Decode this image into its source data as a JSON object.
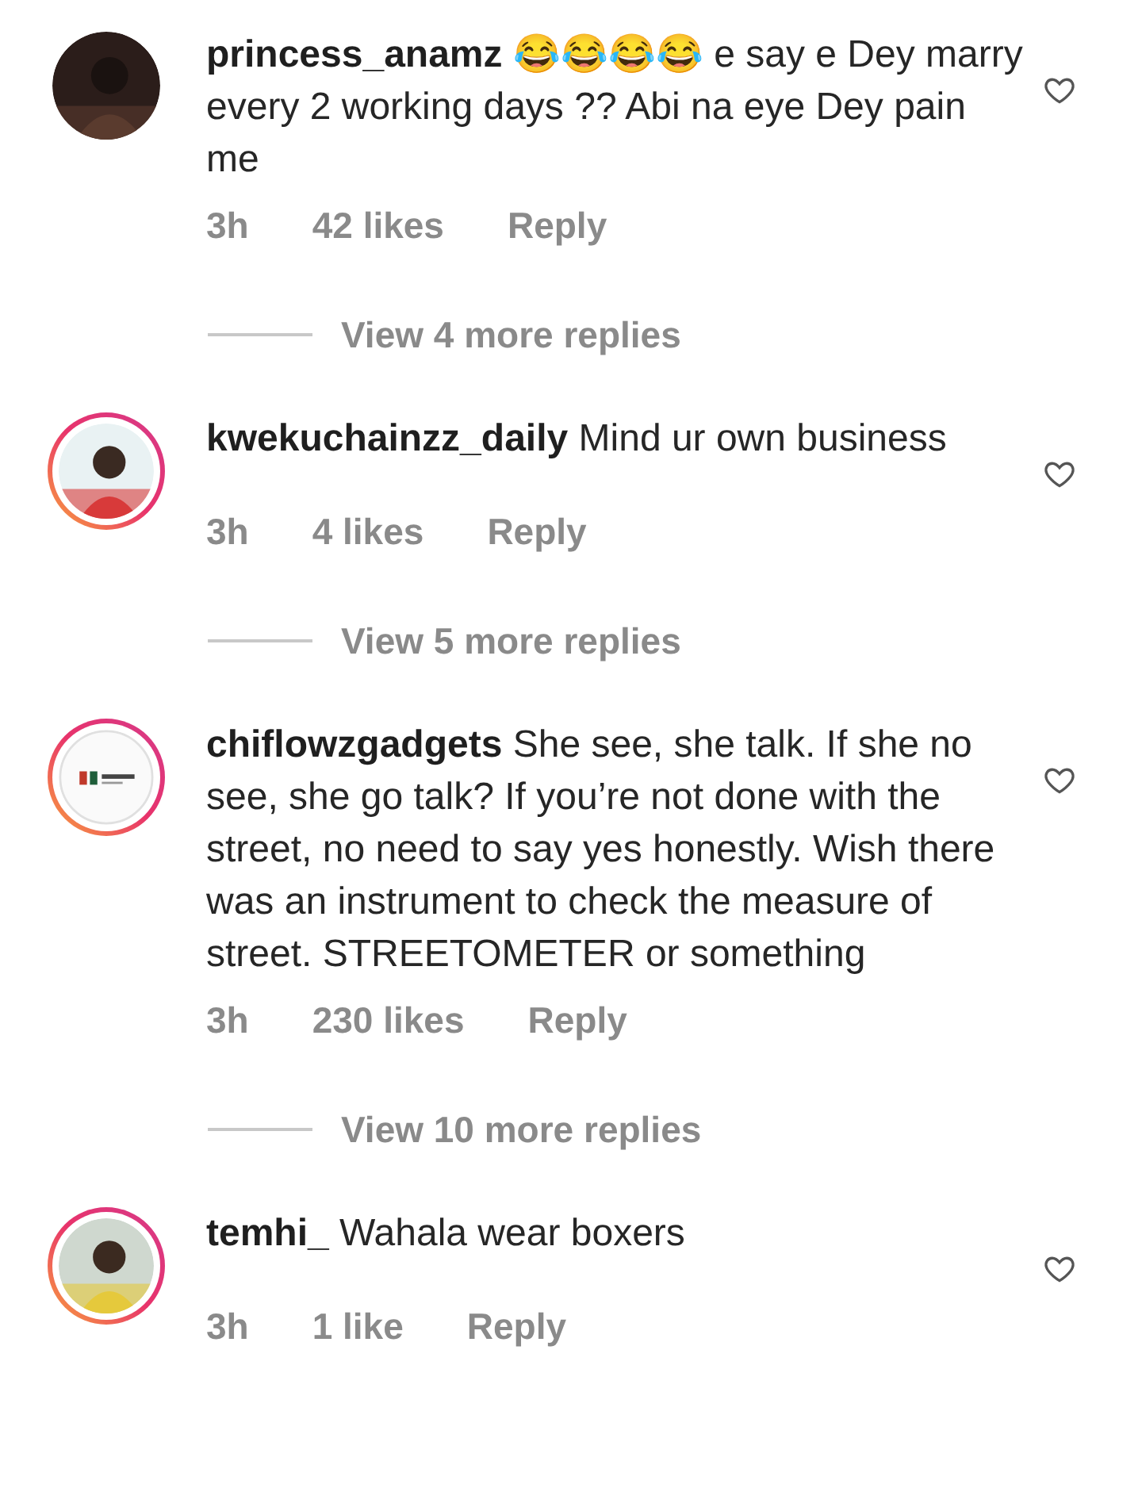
{
  "comments": [
    {
      "username": "princess_anamz",
      "text": "😂😂😂😂 e say e Dey marry every 2 working days ?? Abi na eye Dey pain me",
      "time": "3h",
      "likes": "42 likes",
      "reply": "Reply",
      "story_ring": false,
      "more_replies": "View 4 more replies"
    },
    {
      "username": "kwekuchainzz_daily",
      "text": "Mind ur own business",
      "time": "3h",
      "likes": "4 likes",
      "reply": "Reply",
      "story_ring": true,
      "more_replies": "View 5 more replies"
    },
    {
      "username": "chiflowzgadgets",
      "text": "She see, she talk. If she no see, she go talk? If you’re not done with the street, no need to say yes honestly. Wish there was an instrument to check the measure of street. STREETOMETER or something",
      "time": "3h",
      "likes": "230 likes",
      "reply": "Reply",
      "story_ring": true,
      "avatar": {
        "kind": "logo"
      },
      "more_replies": "View 10 more replies"
    },
    {
      "username": "temhi_",
      "text": "Wahala wear boxers",
      "time": "3h",
      "likes": "1 like",
      "reply": "Reply",
      "story_ring": true
    }
  ]
}
